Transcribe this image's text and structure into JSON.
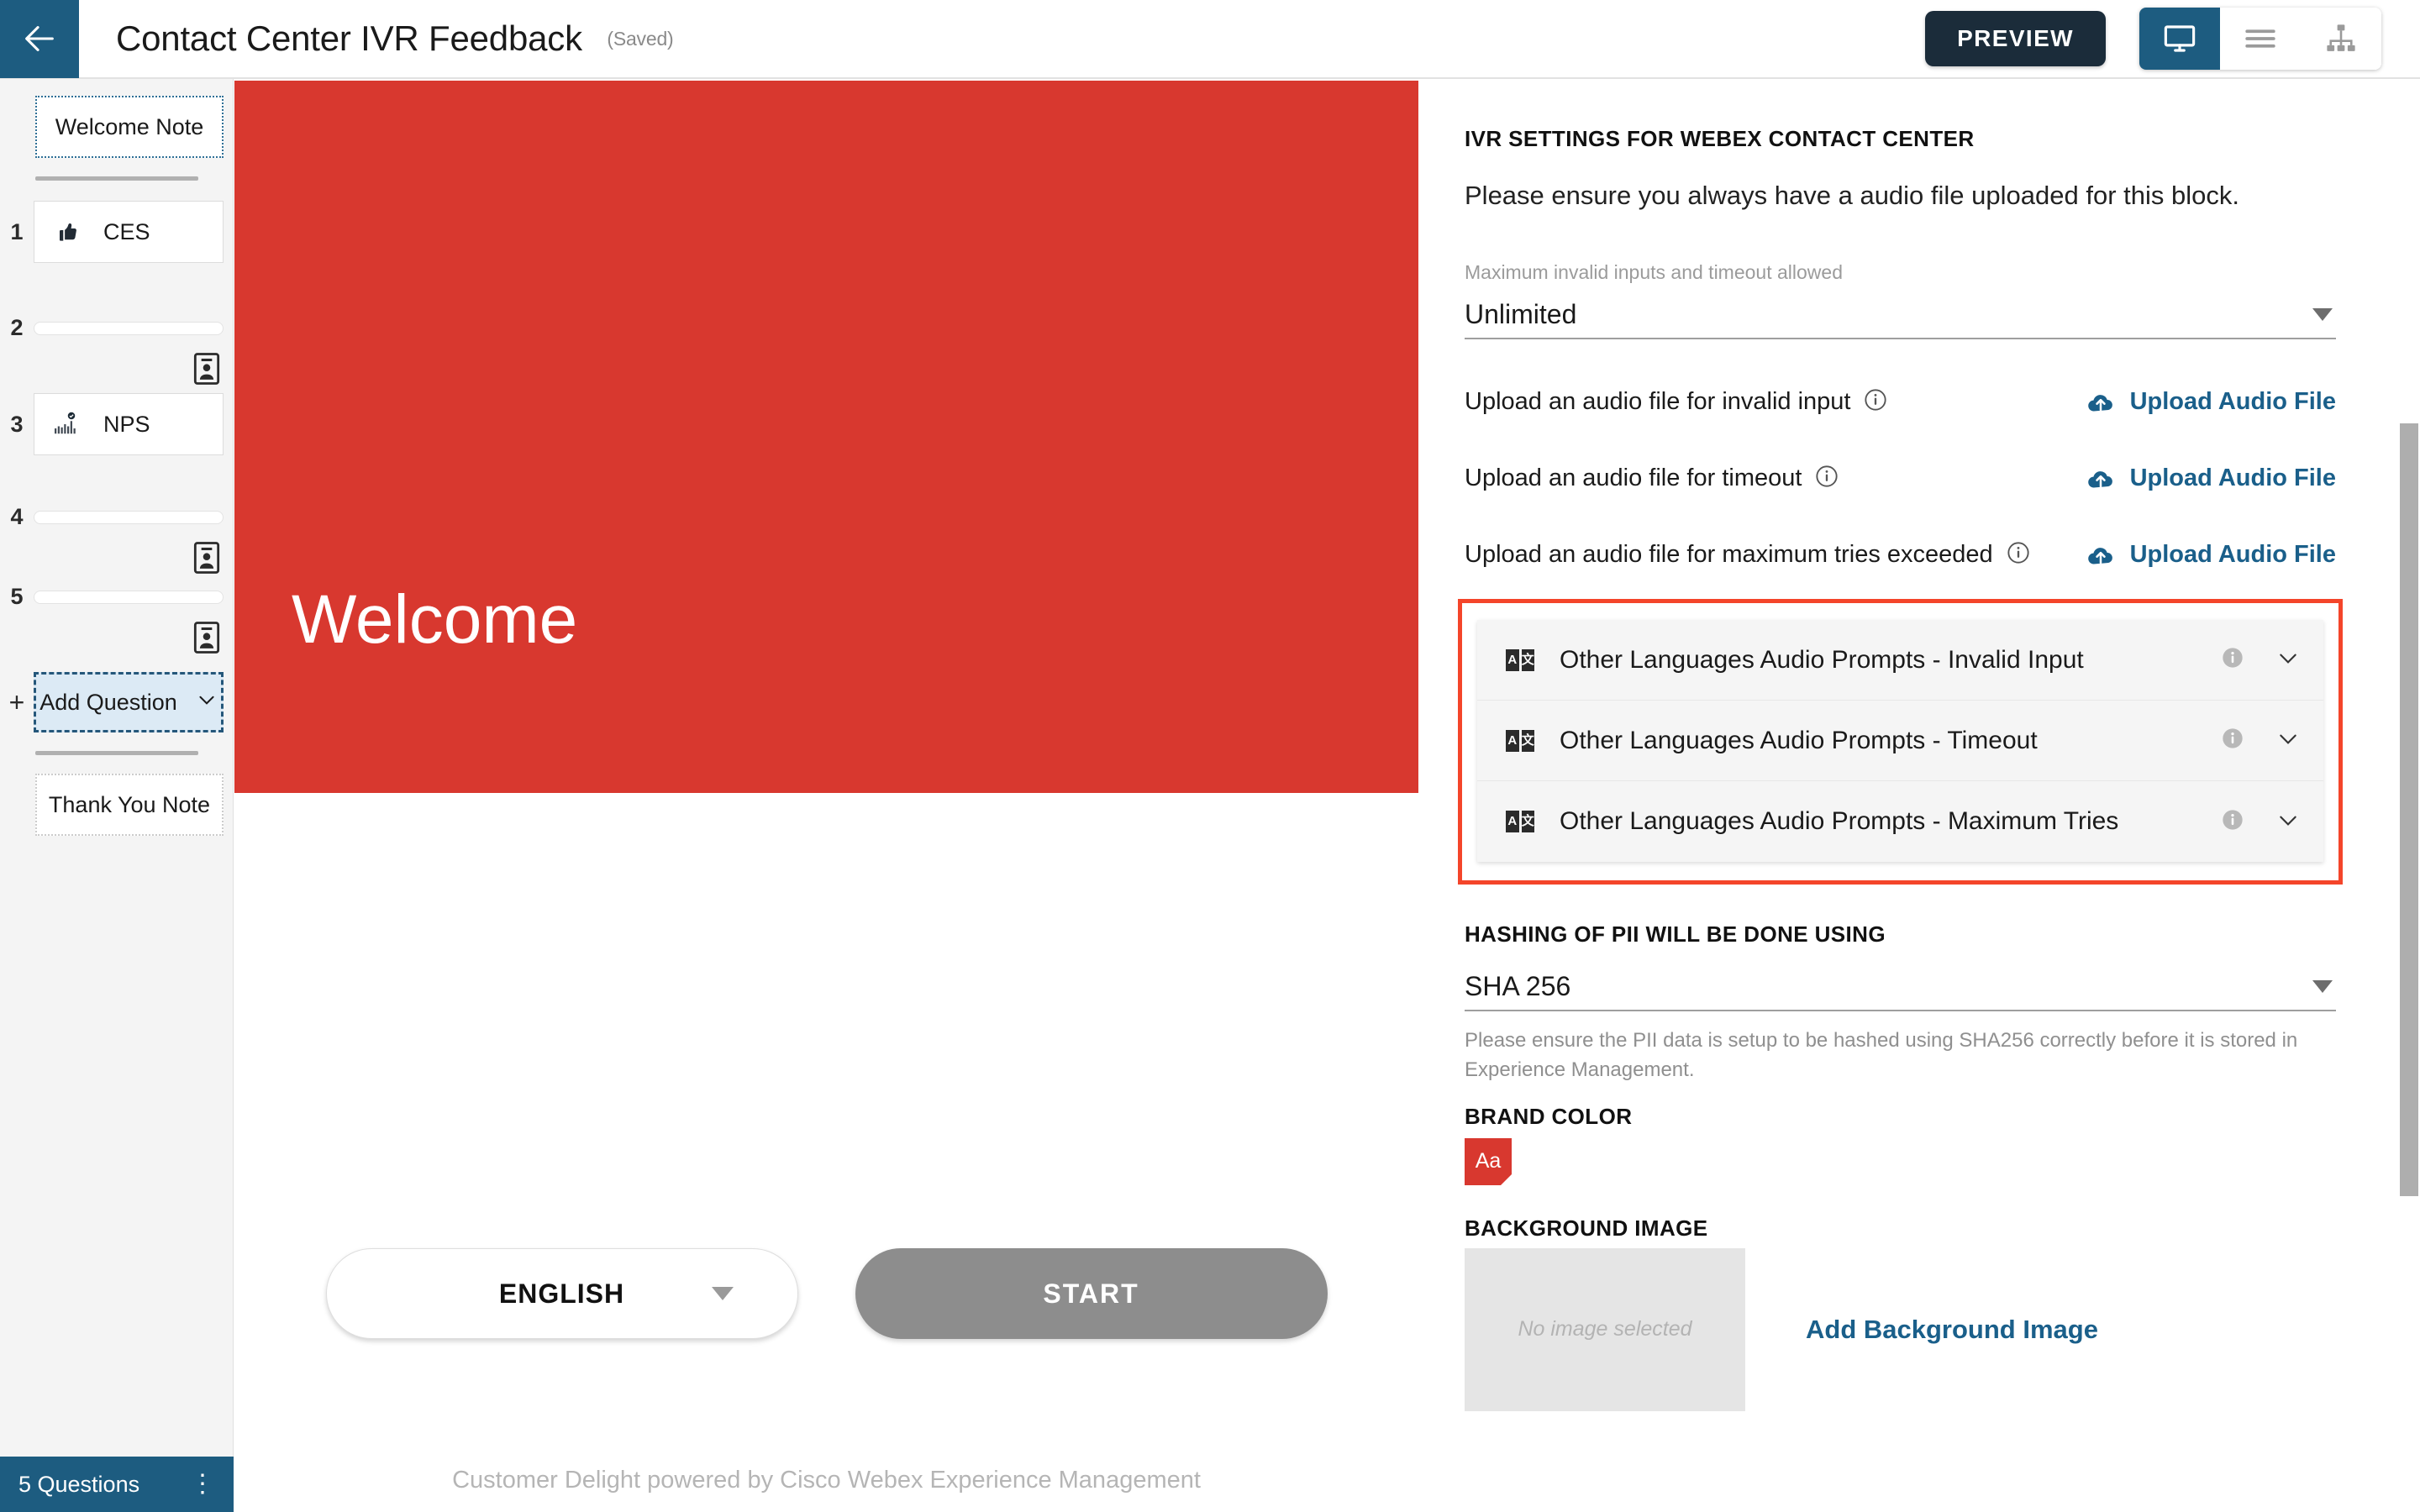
{
  "topbar": {
    "back_icon": "arrow-left-icon",
    "title": "Contact Center IVR Feedback",
    "saved_label": "(Saved)",
    "preview_label": "PREVIEW",
    "view_modes": [
      {
        "name": "desktop-view",
        "icon": "monitor-icon",
        "active": true
      },
      {
        "name": "list-view",
        "icon": "hamburger-icon",
        "active": false
      },
      {
        "name": "flow-view",
        "icon": "sitemap-icon",
        "active": false
      }
    ]
  },
  "sidebar": {
    "welcome_note_label": "Welcome Note",
    "thankyou_note_label": "Thank You Note",
    "add_question_label": "Add Question",
    "add_question_plus": "+",
    "add_question_chevron": "⌄",
    "questions": [
      {
        "number": "1",
        "label": "CES",
        "icon": "thumbs-up-icon",
        "type": "card"
      },
      {
        "number": "2",
        "label": "",
        "icon": "id-card-icon",
        "type": "slim"
      },
      {
        "number": "3",
        "label": "NPS",
        "icon": "nps-bars-icon",
        "type": "card"
      },
      {
        "number": "4",
        "label": "",
        "icon": "id-card-icon",
        "type": "slim"
      },
      {
        "number": "5",
        "label": "",
        "icon": "id-card-icon",
        "type": "slim"
      }
    ],
    "footer_count": "5 Questions",
    "footer_menu_icon": "kebab-menu-icon"
  },
  "preview": {
    "hero_title": "Welcome",
    "language_value": "ENGLISH",
    "start_label": "START",
    "footer_text": "Customer Delight powered by Cisco Webex Experience Management",
    "brand_color": "#d8382f"
  },
  "settings": {
    "section_title": "IVR SETTINGS FOR WEBEX CONTACT CENTER",
    "section_subtitle": "Please ensure you always have a audio file uploaded for this block.",
    "max_invalid_label": "Maximum invalid inputs and timeout allowed",
    "max_invalid_value": "Unlimited",
    "upload_rows": [
      {
        "label": "Upload an audio file for invalid input",
        "action": "Upload Audio File",
        "info_icon": "info-icon",
        "upload_icon": "cloud-upload-icon"
      },
      {
        "label": "Upload an audio file for timeout",
        "action": "Upload Audio File",
        "info_icon": "info-icon",
        "upload_icon": "cloud-upload-icon"
      },
      {
        "label": "Upload an audio file for maximum tries exceeded",
        "action": "Upload Audio File",
        "info_icon": "info-icon",
        "upload_icon": "cloud-upload-icon"
      }
    ],
    "highlight_color": "#f4452a",
    "language_prompts": [
      {
        "label": "Other Languages Audio Prompts - Invalid Input",
        "icon": "translate-icon",
        "info_icon": "info-icon",
        "chevron": "chevron-down-icon"
      },
      {
        "label": "Other Languages Audio Prompts - Timeout",
        "icon": "translate-icon",
        "info_icon": "info-icon",
        "chevron": "chevron-down-icon"
      },
      {
        "label": "Other Languages Audio Prompts - Maximum Tries",
        "icon": "translate-icon",
        "info_icon": "info-icon",
        "chevron": "chevron-down-icon"
      }
    ],
    "hashing_title": "HASHING OF PII WILL BE DONE USING",
    "hashing_value": "SHA 256",
    "hashing_help": "Please ensure the PII data is setup to be hashed using SHA256 correctly before it is stored in Experience Management.",
    "brand_color_title": "BRAND COLOR",
    "brand_color_swatch_text": "Aa",
    "brand_color_value": "#d8382f",
    "background_image_title": "BACKGROUND IMAGE",
    "background_image_placeholder": "No image selected",
    "add_background_label": "Add Background Image"
  }
}
